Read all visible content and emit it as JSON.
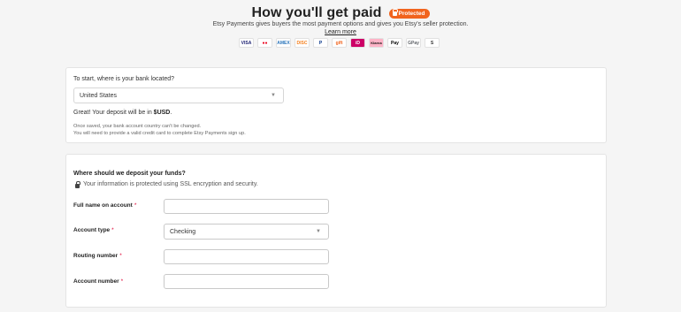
{
  "header": {
    "title": "How you'll get paid",
    "badge": "Protected",
    "subtitle": "Etsy Payments gives buyers the most payment options and gives you Etsy's seller protection.",
    "learn_more": "Learn more"
  },
  "payment_logos": [
    {
      "name": "visa-logo",
      "text": "VISA",
      "color": "#1a1f71"
    },
    {
      "name": "mastercard-logo",
      "text": "●●",
      "color": "#eb001b"
    },
    {
      "name": "amex-logo",
      "text": "AMEX",
      "color": "#2e77bc"
    },
    {
      "name": "discover-logo",
      "text": "DISC",
      "color": "#f48120"
    },
    {
      "name": "paypal-logo",
      "text": "P",
      "color": "#003087"
    },
    {
      "name": "etsy-giftcard-logo",
      "text": "gift",
      "color": "#f1641e"
    },
    {
      "name": "ideal-logo",
      "text": "iD",
      "color": "#cc0066"
    },
    {
      "name": "klarna-logo",
      "text": "Klarna",
      "color": "#ffb3c7"
    },
    {
      "name": "apple-pay-logo",
      "text": "Pay",
      "color": "#000000"
    },
    {
      "name": "google-pay-logo",
      "text": "GPay",
      "color": "#5f6368"
    },
    {
      "name": "sofort-logo",
      "text": "S",
      "color": "#333333"
    }
  ],
  "bank_location": {
    "question": "To start, where is your bank located?",
    "selected_country": "United States",
    "deposit_prefix": "Great! Your deposit will be in ",
    "deposit_currency": "$USD",
    "deposit_suffix": ".",
    "note_line1": "Once saved, your bank account country can't be changed.",
    "note_line2": "You will need to provide a valid credit card to complete Etsy Payments sign up."
  },
  "deposit": {
    "heading": "Where should we deposit your funds?",
    "security_note": "Your information is protected using SSL encryption and security.",
    "fields": {
      "full_name_label": "Full name on account",
      "account_type_label": "Account type",
      "account_type_value": "Checking",
      "routing_label": "Routing number",
      "account_number_label": "Account number",
      "required_mark": "*"
    }
  },
  "colors": {
    "accent": "#f1641e",
    "required": "#dd0033"
  }
}
